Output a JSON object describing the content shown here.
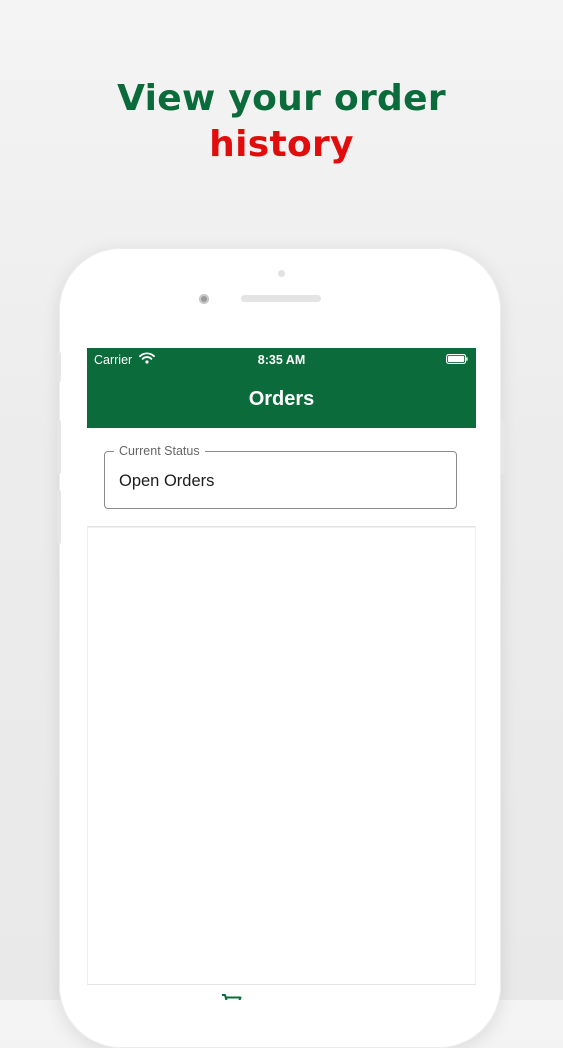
{
  "headline": {
    "line1": "View your order",
    "line2": "history"
  },
  "statusbar": {
    "carrier": "Carrier",
    "time": "8:35 AM",
    "wifi_icon": "wifi-icon",
    "battery_icon": "battery-icon"
  },
  "appbar": {
    "title": "Orders"
  },
  "status_filter": {
    "label": "Current Status",
    "value": "Open Orders"
  },
  "tabbar": {
    "icons": [
      "cart-icon"
    ]
  },
  "colors": {
    "brand_green": "#0b6b3a",
    "accent_red": "#e10c0c"
  }
}
